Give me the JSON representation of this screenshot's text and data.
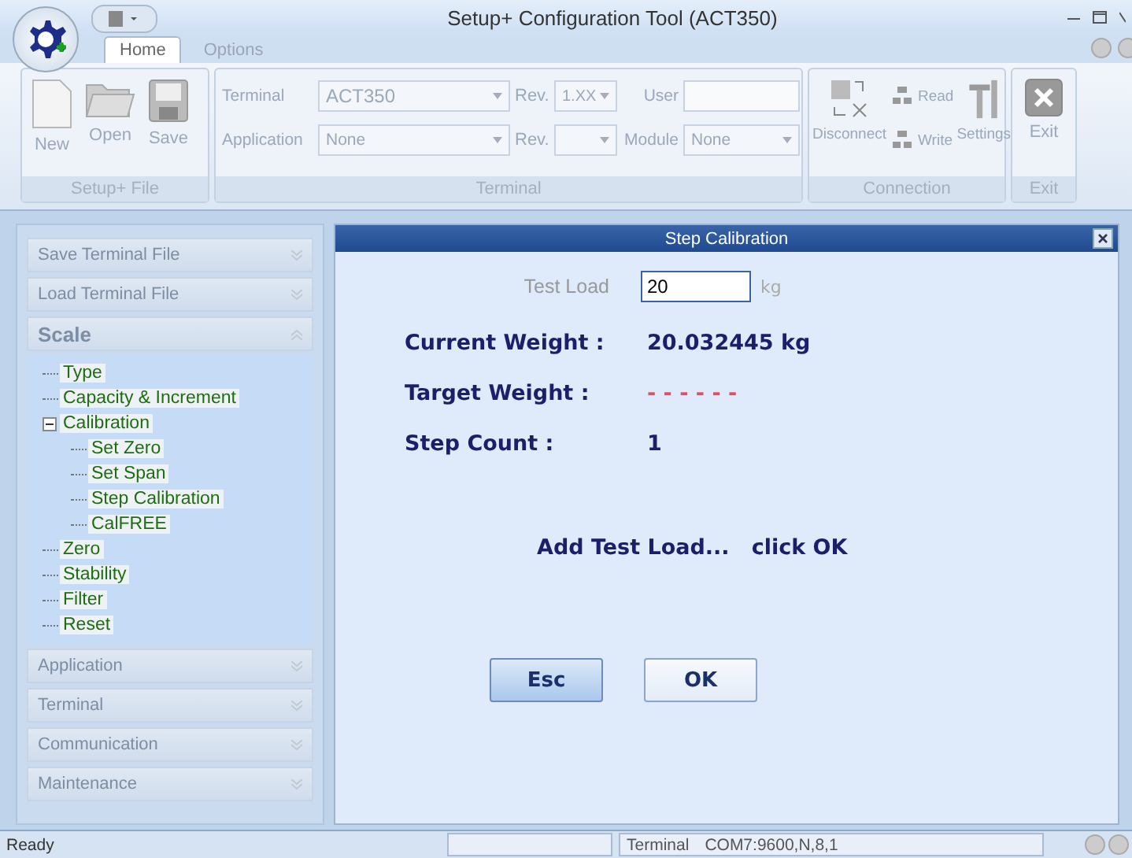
{
  "window": {
    "title": "Setup+ Configuration Tool (ACT350)"
  },
  "tabs": [
    {
      "label": "Home",
      "selected": true
    },
    {
      "label": "Options",
      "selected": false
    }
  ],
  "ribbon": {
    "disabled": true,
    "file_group": {
      "label": "Setup+ File",
      "buttons": [
        {
          "label": "New",
          "kind": "new"
        },
        {
          "label": "Open",
          "kind": "open"
        },
        {
          "label": "Save",
          "kind": "save"
        }
      ]
    },
    "terminal_group": {
      "label": "Terminal",
      "rows": [
        {
          "label": "Terminal",
          "value": "ACT350",
          "rev_label": "Rev.",
          "rev_value": "1.XX",
          "extra": {
            "label": "User",
            "kind": "text"
          }
        },
        {
          "label": "Application",
          "value": "None",
          "rev_label": "Rev.",
          "extra": {
            "label": "Module",
            "value": "None",
            "kind": "combo"
          }
        }
      ]
    },
    "connection_group": {
      "label": "Connection",
      "disconnect": "Disconnect",
      "read": "Read",
      "write": "Write",
      "settings": "Settings"
    },
    "exit_group": {
      "label": "Exit",
      "button": "Exit"
    }
  },
  "sidebar": {
    "sections": [
      {
        "label": "Save Terminal File",
        "expanded": false
      },
      {
        "label": "Load Terminal File",
        "expanded": false
      },
      {
        "label": "Scale",
        "expanded": true,
        "items": [
          {
            "label": "Type"
          },
          {
            "label": "Capacity & Increment"
          },
          {
            "label": "Calibration",
            "expanded": true,
            "children": [
              {
                "label": "Set Zero"
              },
              {
                "label": "Set Span"
              },
              {
                "label": "Step Calibration"
              },
              {
                "label": "CalFREE"
              }
            ]
          },
          {
            "label": "Zero"
          },
          {
            "label": "Stability"
          },
          {
            "label": "Filter"
          },
          {
            "label": "Reset"
          }
        ]
      },
      {
        "label": "Application",
        "expanded": false
      },
      {
        "label": "Terminal",
        "expanded": false
      },
      {
        "label": "Communication",
        "expanded": false
      },
      {
        "label": "Maintenance",
        "expanded": false
      }
    ]
  },
  "dialog": {
    "title": "Step Calibration",
    "test_load": {
      "label": "Test Load",
      "value": "20",
      "unit": "kg"
    },
    "rows": [
      {
        "label": "Current Weight :",
        "value": "20.032445 kg",
        "kind": "value"
      },
      {
        "label": "Target Weight :",
        "value": "- - - - - -",
        "kind": "pending"
      },
      {
        "label": "Step Count :",
        "value": "1",
        "kind": "value"
      }
    ],
    "message": "Add Test Load...   click OK",
    "buttons": [
      {
        "label": "Esc",
        "focused": true
      },
      {
        "label": "OK",
        "focused": false
      }
    ]
  },
  "status_bar": {
    "text": "Ready",
    "port_label": "Terminal",
    "port_value": "COM7:9600,N,8,1"
  }
}
